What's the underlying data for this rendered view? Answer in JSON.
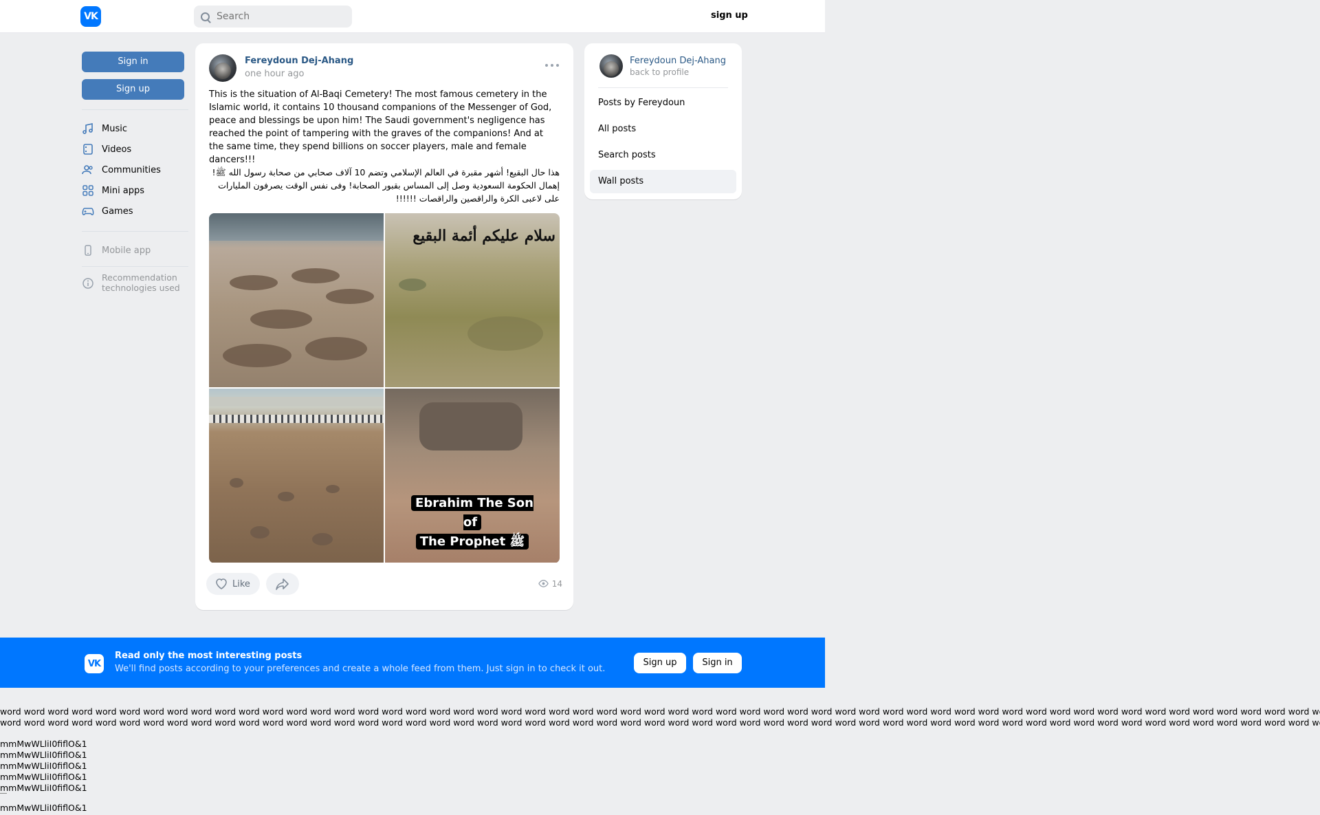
{
  "header": {
    "logo_text": "VK",
    "search_placeholder": "Search",
    "signup_label": "sign up"
  },
  "left_nav": {
    "sign_in": "Sign in",
    "sign_up": "Sign up",
    "items": [
      {
        "label": "Music",
        "icon": "music-note-icon"
      },
      {
        "label": "Videos",
        "icon": "video-icon"
      },
      {
        "label": "Communities",
        "icon": "users-icon"
      },
      {
        "label": "Mini apps",
        "icon": "apps-grid-icon"
      },
      {
        "label": "Games",
        "icon": "gamepad-icon"
      }
    ],
    "mobile_app": "Mobile app",
    "recommendation_line1": "Recommendation",
    "recommendation_line2": "technologies used"
  },
  "post": {
    "author": "Fereydoun Dej-Ahang",
    "time": "one hour ago",
    "text": "This is the situation of Al-Baqi Cemetery! The most famous cemetery in the Islamic world, it contains 10 thousand companions of the Messenger of God, peace and blessings be upon him! The Saudi government's negligence has reached the point of tampering with the graves of the companions! And at the same time, they spend billions on soccer players, male and female dancers!!!",
    "text_ar": "هذا حال البقيع! أشهر مقبرة في العالم الإسلامي وتضم 10 آلاف صحابي من صحابة رسول الله ﷺ! إهمال الحكومة السعودية وصل إلى المساس بقبور الصحابة! وفى نفس الوقت يصرفون المليارات على لاعبى الكرة والراقصين والراقصات !!!!!!",
    "photo_2_text": "سلام عليكم أئمة البقيع",
    "photo_4_caption_line1": "Ebrahim The Son of",
    "photo_4_caption_line2": "The Prophet ﷺ",
    "like_label": "Like",
    "views": "14"
  },
  "side": {
    "name": "Fereydoun Dej-Ahang",
    "back": "back to profile",
    "items": [
      {
        "label": "Posts by Fereydoun"
      },
      {
        "label": "All posts"
      },
      {
        "label": "Search posts"
      },
      {
        "label": "Wall posts"
      }
    ]
  },
  "banner": {
    "logo_text": "VK",
    "title": "Read only the most interesting posts",
    "subtitle": "We'll find posts according to your preferences and create a whole feed from them. Just sign in to check it out.",
    "sign_up": "Sign up",
    "sign_in": "Sign in"
  },
  "filler": {
    "words_line1": "word word word word word word word word word word word word word word word word word word word word word word word word word word word word word word word word word word word word word word word word word word word word word word word word word word word word word word word word word word word word word word word word word word word word word",
    "words_line2": "word word word word word word word word word word word word word word word word word word word word word word word word word word word word word word word word word word word word word word word word word word word word word word word word word word word word word word word word word word word word word word word word word word word word word word",
    "mm": "mmMwWLliI0fiflO&1"
  },
  "colors": {
    "brand": "#0077ff",
    "button_blue": "#447bba",
    "link": "#2a5885",
    "page_bg": "#edeef0"
  }
}
